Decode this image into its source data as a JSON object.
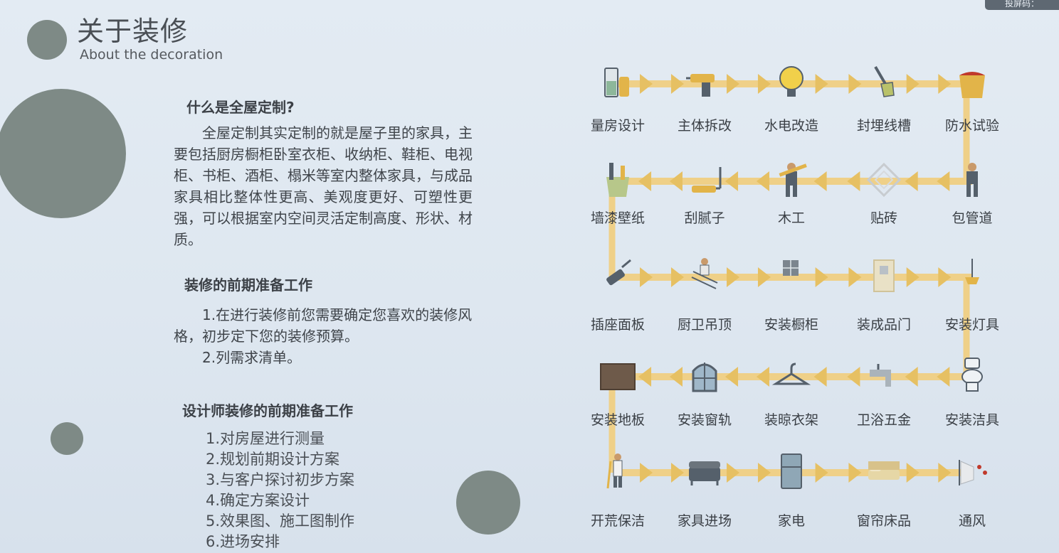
{
  "header": {
    "title": "关于装修",
    "subtitle": "About the decoration"
  },
  "corner_badge": "投屏码：",
  "intro": {
    "question": "什么是全屋定制?",
    "answer": "全屋定制其实定制的就是屋子里的家具，主要包括厨房橱柜卧室衣柜、收纳柜、鞋柜、电视柜、书柜、酒柜、榻米等室内整体家具，与成品家具相比整体性更高、美观度更好、可塑性更强，可以根据室内空间灵活定制高度、形状、材质。"
  },
  "preparation": {
    "title": "装修的前期准备工作",
    "line1": "1.在进行装修前您需要确定您喜欢的装修风格，初步定下您的装修预算。",
    "line2": "2.列需求清单。"
  },
  "designer": {
    "title": "设计师装修的前期准备工作",
    "items": [
      "1.对房屋进行测量",
      "2.规划前期设计方案",
      "3.与客户探讨初步方案",
      "4.确定方案设计",
      "5.效果图、施工图制作",
      "6.进场安排"
    ]
  },
  "flow": {
    "rows": [
      [
        {
          "label": "量房设计",
          "icon": "measuring-bottles-icon"
        },
        {
          "label": "主体拆改",
          "icon": "drill-icon"
        },
        {
          "label": "水电改造",
          "icon": "light-bulb-icon"
        },
        {
          "label": "封埋线槽",
          "icon": "trowel-icon"
        },
        {
          "label": "防水试验",
          "icon": "paint-bucket-icon"
        }
      ],
      [
        {
          "label": "墙漆壁纸",
          "icon": "paint-brushes-icon"
        },
        {
          "label": "刮腻子",
          "icon": "paint-roller-icon"
        },
        {
          "label": "木工",
          "icon": "carpenter-icon"
        },
        {
          "label": "贴砖",
          "icon": "tile-icon"
        },
        {
          "label": "包管道",
          "icon": "worker-icon"
        }
      ],
      [
        {
          "label": "插座面板",
          "icon": "plug-icon"
        },
        {
          "label": "厨卫吊顶",
          "icon": "ladder-worker-icon"
        },
        {
          "label": "安装橱柜",
          "icon": "cabinet-icon"
        },
        {
          "label": "装成品门",
          "icon": "door-icon"
        },
        {
          "label": "安装灯具",
          "icon": "lamp-icon"
        }
      ],
      [
        {
          "label": "安装地板",
          "icon": "floor-board-icon"
        },
        {
          "label": "安装窗轨",
          "icon": "window-icon"
        },
        {
          "label": "装晾衣架",
          "icon": "hanger-icon"
        },
        {
          "label": "卫浴五金",
          "icon": "faucet-icon"
        },
        {
          "label": "安装洁具",
          "icon": "toilet-icon"
        }
      ],
      [
        {
          "label": "开荒保洁",
          "icon": "cleaner-icon"
        },
        {
          "label": "家具进场",
          "icon": "sofa-icon"
        },
        {
          "label": "家电",
          "icon": "fridge-icon"
        },
        {
          "label": "窗帘床品",
          "icon": "bed-icon"
        },
        {
          "label": "通风",
          "icon": "ventilation-icon"
        }
      ]
    ],
    "colors": {
      "track": "#efd088",
      "arrow": "#e6c063",
      "icon_dark": "#55606b",
      "icon_accent": "#e2b449"
    }
  },
  "colors": {
    "circle": "#7e8a86"
  }
}
